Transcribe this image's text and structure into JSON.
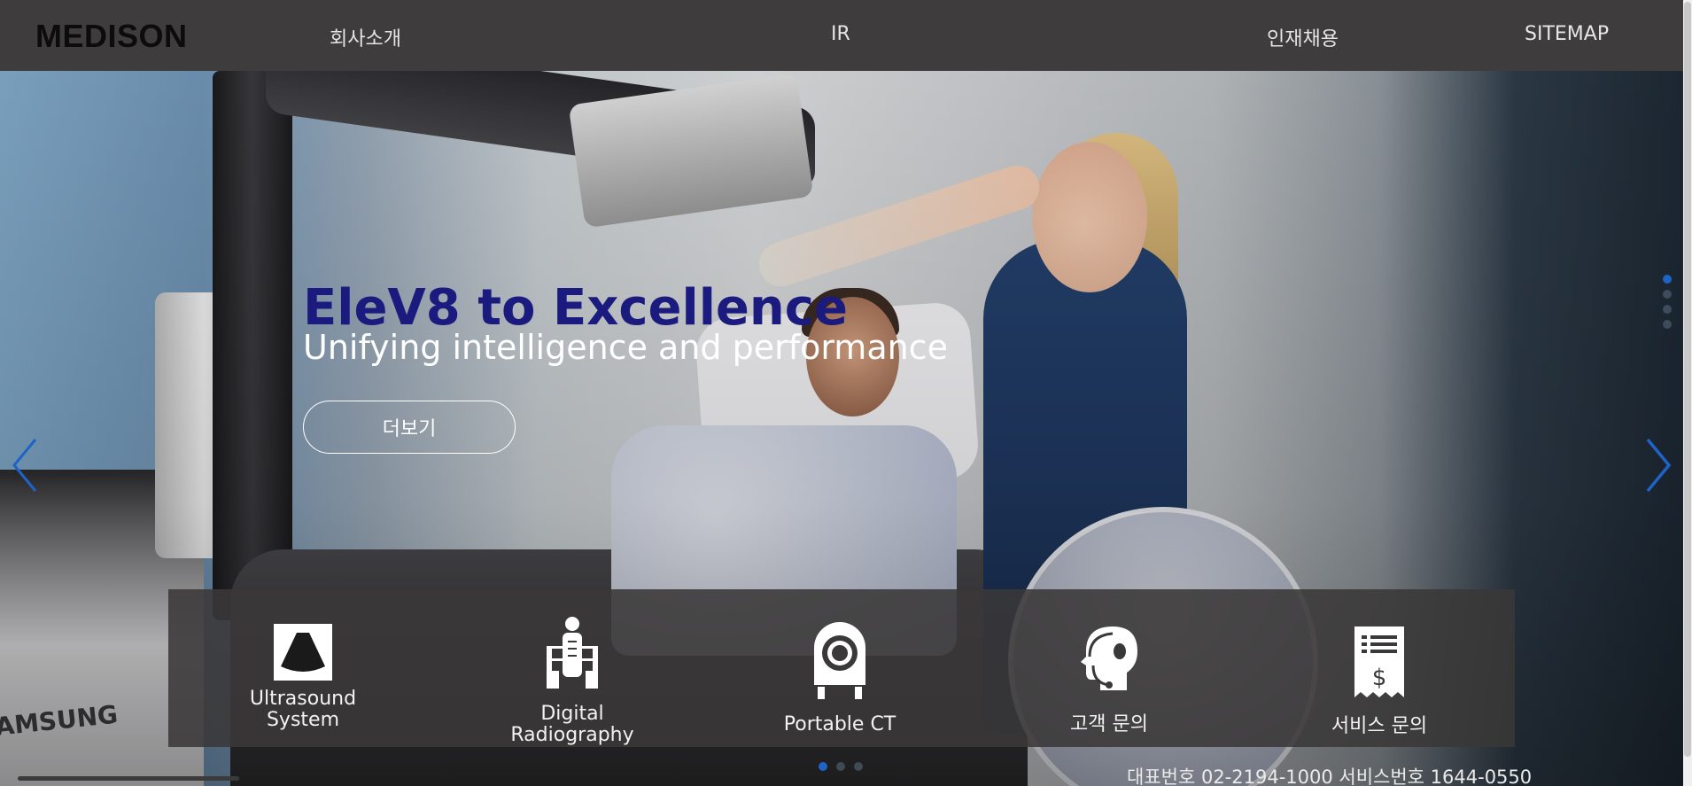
{
  "header": {
    "logo": "MEDISON",
    "nav": [
      {
        "label": "회사소개"
      },
      {
        "label": "IR"
      },
      {
        "label": "인재채용"
      },
      {
        "label": "SITEMAP"
      }
    ]
  },
  "hero": {
    "title": "EleV8 to Excellence",
    "subtitle": "Unifying intelligence and performance",
    "more_button": "더보기",
    "brand_watermark": "AMSUNG",
    "vertical_dots": {
      "count": 4,
      "active": 0
    },
    "bottom_dots": {
      "count": 3,
      "active": 0
    }
  },
  "quick_links": [
    {
      "icon": "ultrasound-probe-icon",
      "line1": "Ultrasound",
      "line2": "System"
    },
    {
      "icon": "digital-radiography-icon",
      "line1": "Digital",
      "line2": "Radiography"
    },
    {
      "icon": "portable-ct-icon",
      "line1": "Portable CT",
      "line2": ""
    },
    {
      "icon": "customer-support-headset-icon",
      "line1": "고객 문의",
      "line2": ""
    },
    {
      "icon": "service-receipt-icon",
      "line1": "서비스 문의",
      "line2": ""
    }
  ],
  "footer": {
    "contact": "대표번호 02-2194-1000 서비스번호 1644-0550"
  },
  "colors": {
    "topbar": "#3e3c3c",
    "title": "#1b1a7e",
    "accent": "#1d63c8",
    "panel": "#3a3838"
  }
}
